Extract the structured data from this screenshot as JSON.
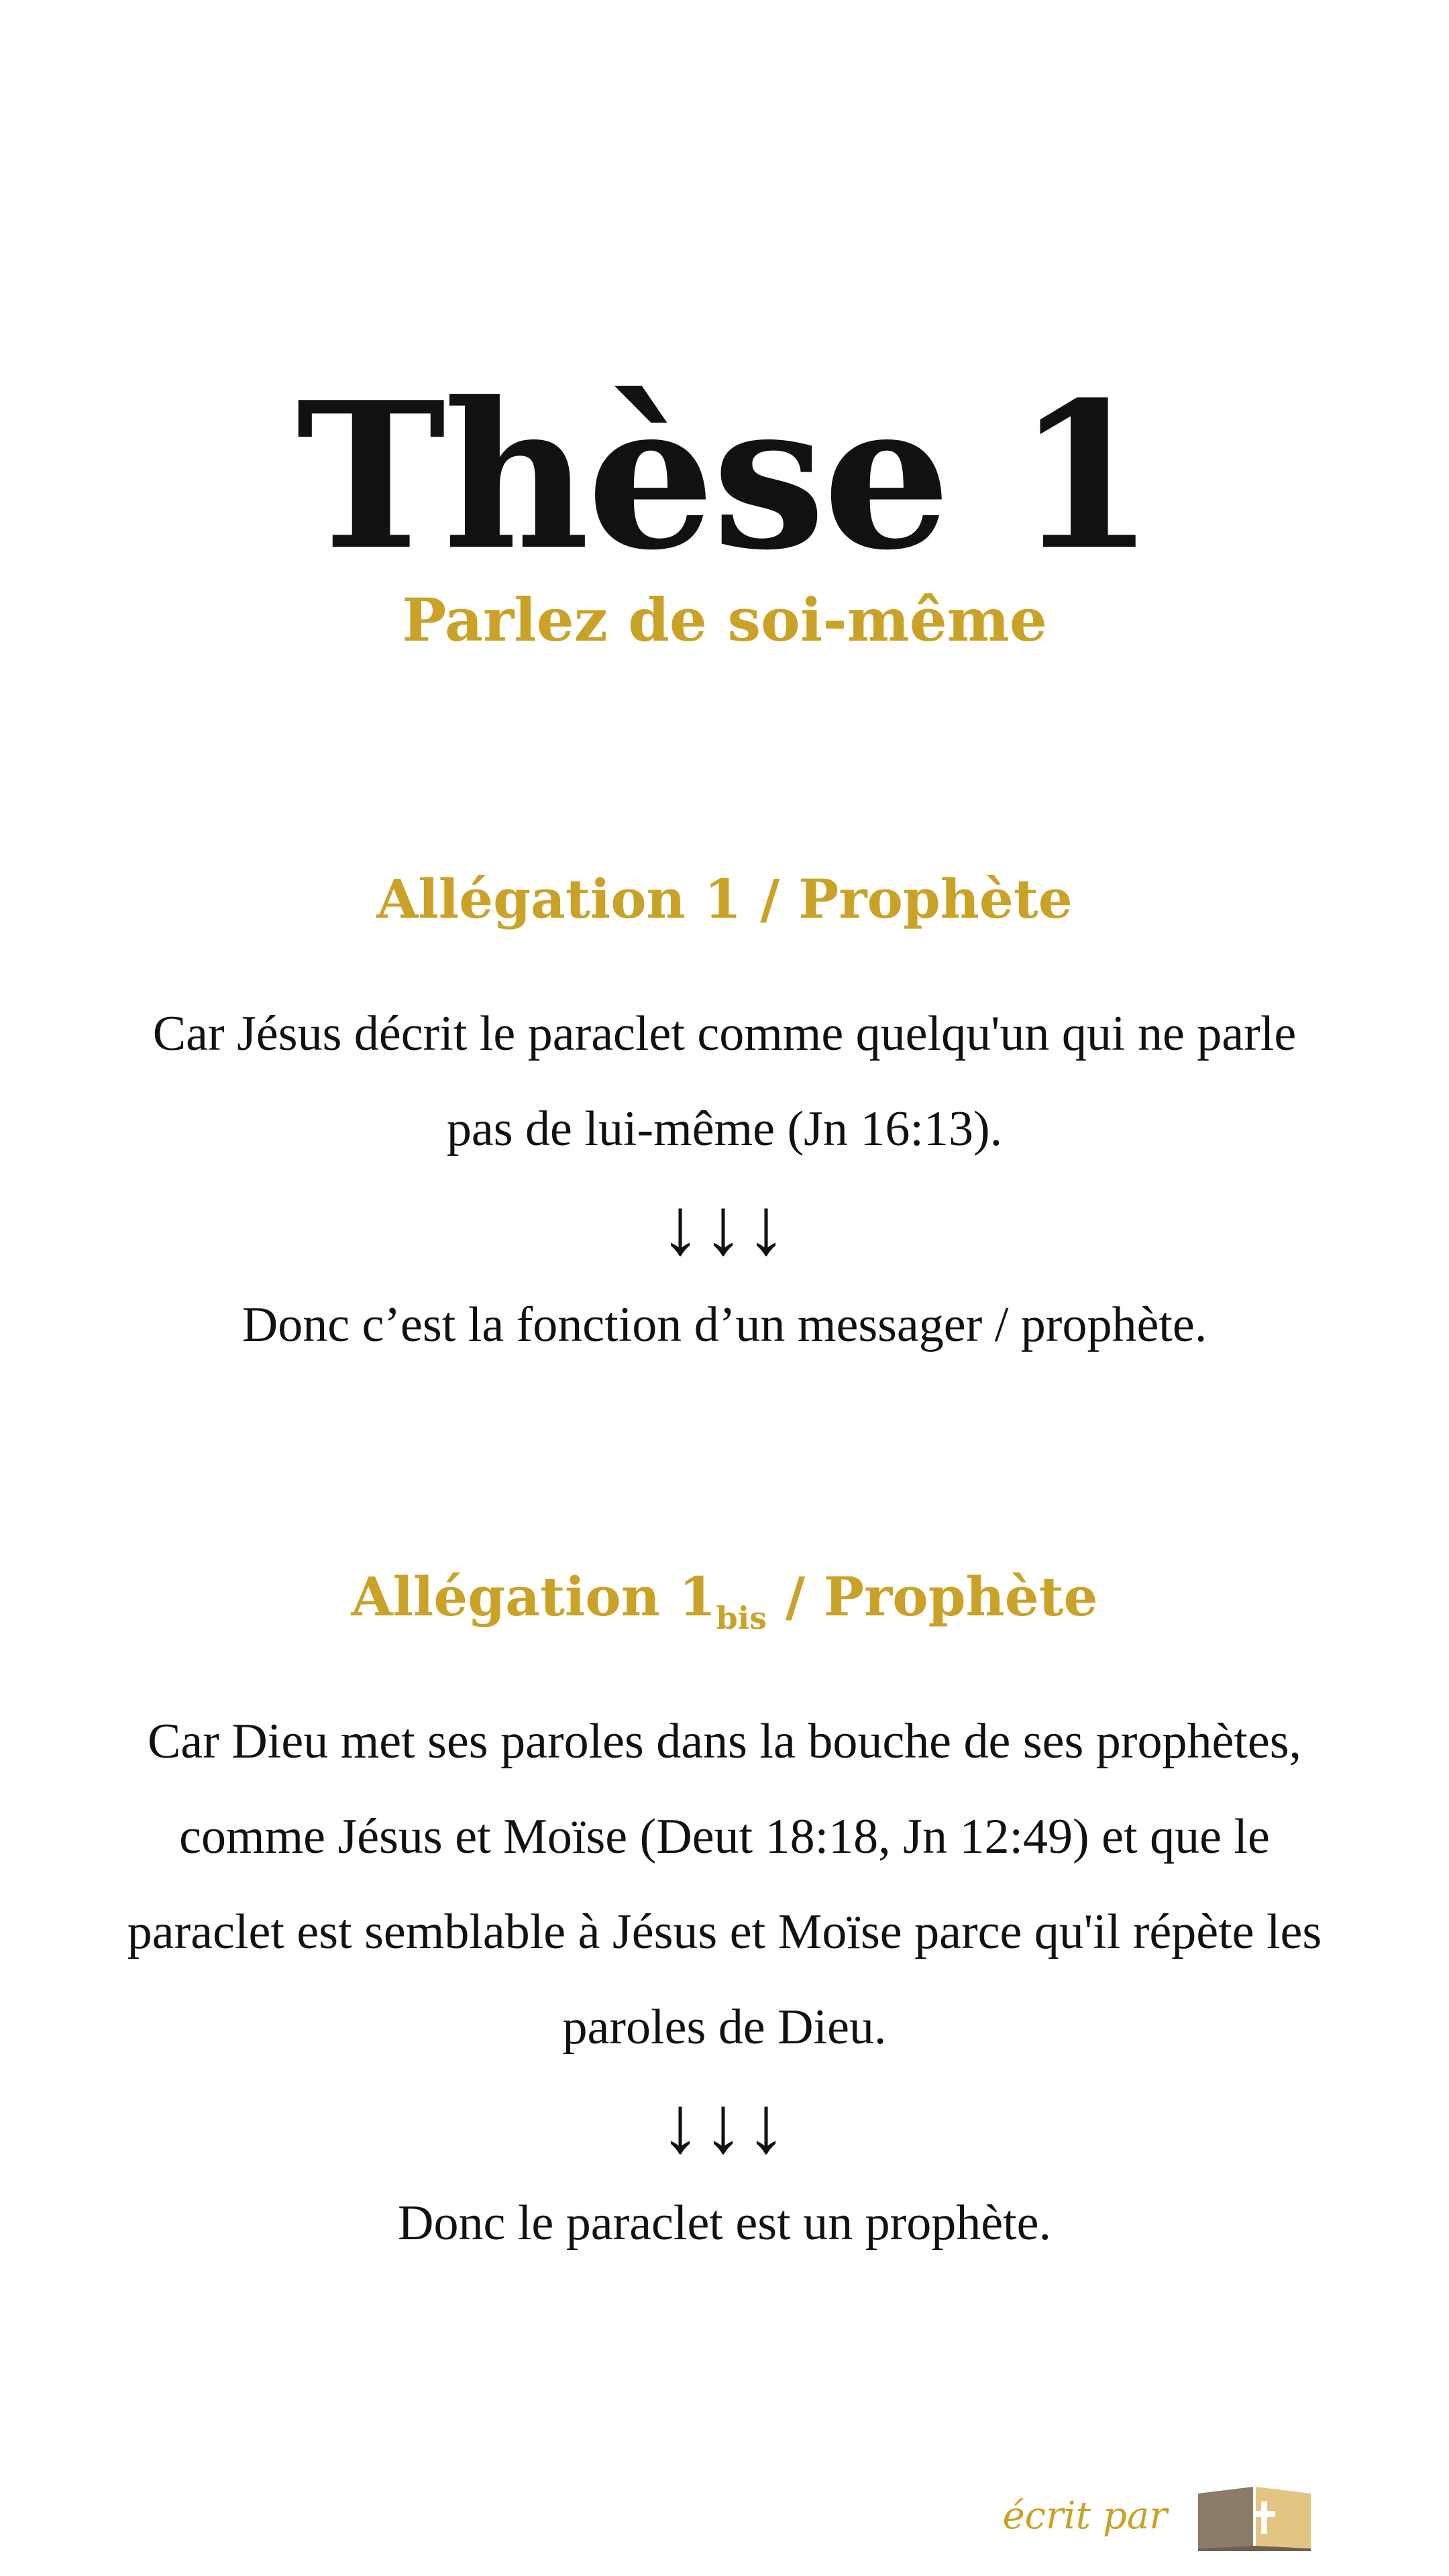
{
  "title": "Thèse 1",
  "subtitle": "Parlez de soi-même",
  "section1": {
    "heading": "Allégation 1 / Prophète",
    "body": "Car Jésus décrit le paraclet comme quelqu'un qui ne parle pas de lui-même (Jn 16:13).",
    "arrows": "↓↓↓",
    "conclusion": "Donc c’est la fonction d’un messager / prophète."
  },
  "section2": {
    "heading_main": "Allégation 1",
    "heading_sub": "bis",
    "heading_rest": " / Prophète",
    "body": "Car Dieu met ses paroles dans la bouche de ses prophètes, comme Jésus et Moïse (Deut 18:18, Jn 12:49) et que le paraclet est semblable à Jésus et Moïse parce qu'il répète les paroles de Dieu.",
    "arrows": "↓↓↓",
    "conclusion": "Donc le paraclet est un prophète."
  },
  "footer": {
    "text": "écrit par",
    "logo_icon": "open-book-cross-icon"
  },
  "colors": {
    "accent": "#c9a227",
    "text": "#111111",
    "background": "#ffffff"
  }
}
